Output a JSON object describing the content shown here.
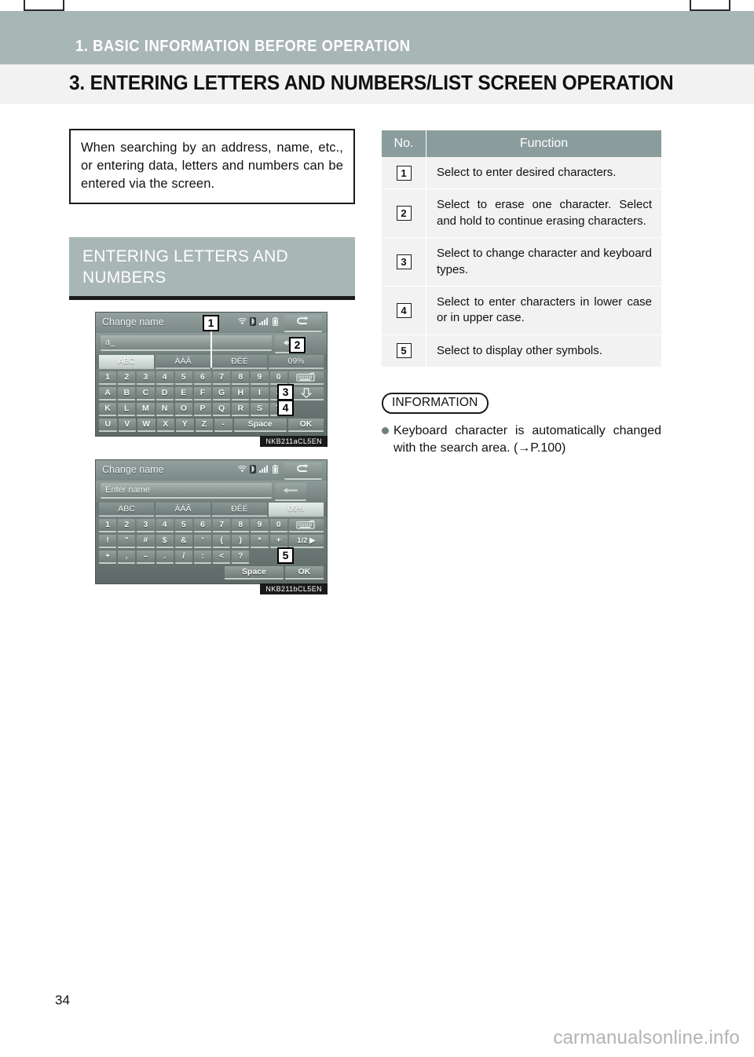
{
  "page": {
    "chapter": "1. BASIC INFORMATION BEFORE OPERATION",
    "section": "3. ENTERING LETTERS AND NUMBERS/LIST SCREEN OPERATION",
    "page_number": "34",
    "watermark": "carmanualsonline.info"
  },
  "intro": {
    "text": "When searching by an address, name, etc., or entering data, letters and numbers can be entered via the screen."
  },
  "subsection": {
    "heading": "ENTERING LETTERS AND NUMBERS"
  },
  "screenshot_alpha": {
    "title": "Change name",
    "input_value": "a_",
    "tabs": [
      "ABC",
      "ÀÁÂ",
      "ÐĒÉ",
      "09%"
    ],
    "active_tab": "ABC",
    "rows": [
      [
        "1",
        "2",
        "3",
        "4",
        "5",
        "6",
        "7",
        "8",
        "9",
        "0",
        "keyboard-icon"
      ],
      [
        "A",
        "B",
        "C",
        "D",
        "E",
        "F",
        "G",
        "H",
        "I",
        "J",
        "shift-down-icon"
      ],
      [
        "K",
        "L",
        "M",
        "N",
        "O",
        "P",
        "Q",
        "R",
        "S",
        "T",
        ""
      ],
      [
        "U",
        "V",
        "W",
        "X",
        "Y",
        "Z",
        "-",
        "Space",
        "OK"
      ]
    ],
    "space_label": "Space",
    "ok_label": "OK",
    "tag": "NKB211aCL5EN",
    "callouts": [
      "1",
      "2",
      "3",
      "4"
    ]
  },
  "screenshot_symbol": {
    "title": "Change name",
    "input_value": "Enter name",
    "tabs": [
      "ABC",
      "ÀÁÂ",
      "ÐĒÉ",
      "09%"
    ],
    "active_tab": "09%",
    "rows": [
      [
        "1",
        "2",
        "3",
        "4",
        "5",
        "6",
        "7",
        "8",
        "9",
        "0",
        "keyboard-icon"
      ],
      [
        "!",
        "\"",
        "#",
        "$",
        "&",
        "'",
        "(",
        ")",
        "*",
        "+",
        "1/2 ▶"
      ],
      [
        "+",
        ",",
        "–",
        ".",
        "/",
        ":",
        "<",
        "?"
      ]
    ],
    "page_toggle_label": "1/2 ▶",
    "space_label": "Space",
    "ok_label": "OK",
    "tag": "NKB211bCL5EN",
    "callouts": [
      "5"
    ]
  },
  "function_table": {
    "headers": [
      "No.",
      "Function"
    ],
    "rows": [
      {
        "no": "1",
        "function": "Select to enter desired characters."
      },
      {
        "no": "2",
        "function": "Select to erase one character. Select and hold to continue erasing characters."
      },
      {
        "no": "3",
        "function": "Select to change character and keyboard types."
      },
      {
        "no": "4",
        "function": "Select to enter characters in lower case or in upper case."
      },
      {
        "no": "5",
        "function": "Select to display other symbols."
      }
    ]
  },
  "information": {
    "label": "INFORMATION",
    "items": [
      "Keyboard character is automatically changed with the search area. (→P.100)"
    ]
  },
  "colors": {
    "chapter_band": "#a9b6b6",
    "section_band": "#f2f2f2",
    "table_header": "#8b9c9c",
    "table_row": "#f2f2f2",
    "bullet": "#6f7f7e",
    "watermark": "#b3b3b3"
  }
}
